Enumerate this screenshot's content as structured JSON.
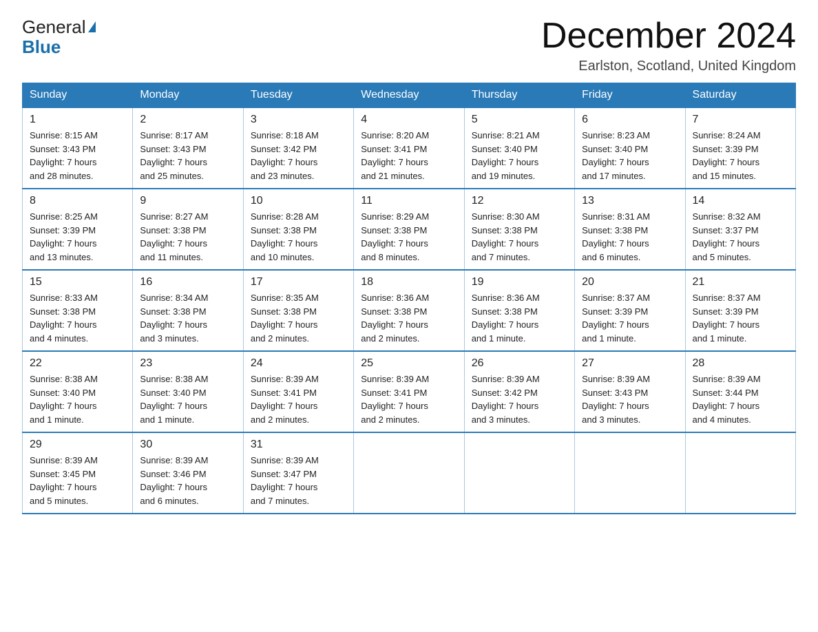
{
  "header": {
    "logo_general": "General",
    "logo_blue": "Blue",
    "month_title": "December 2024",
    "location": "Earlston, Scotland, United Kingdom"
  },
  "weekdays": [
    "Sunday",
    "Monday",
    "Tuesday",
    "Wednesday",
    "Thursday",
    "Friday",
    "Saturday"
  ],
  "weeks": [
    [
      {
        "day": "1",
        "sunrise": "8:15 AM",
        "sunset": "3:43 PM",
        "daylight": "7 hours and 28 minutes."
      },
      {
        "day": "2",
        "sunrise": "8:17 AM",
        "sunset": "3:43 PM",
        "daylight": "7 hours and 25 minutes."
      },
      {
        "day": "3",
        "sunrise": "8:18 AM",
        "sunset": "3:42 PM",
        "daylight": "7 hours and 23 minutes."
      },
      {
        "day": "4",
        "sunrise": "8:20 AM",
        "sunset": "3:41 PM",
        "daylight": "7 hours and 21 minutes."
      },
      {
        "day": "5",
        "sunrise": "8:21 AM",
        "sunset": "3:40 PM",
        "daylight": "7 hours and 19 minutes."
      },
      {
        "day": "6",
        "sunrise": "8:23 AM",
        "sunset": "3:40 PM",
        "daylight": "7 hours and 17 minutes."
      },
      {
        "day": "7",
        "sunrise": "8:24 AM",
        "sunset": "3:39 PM",
        "daylight": "7 hours and 15 minutes."
      }
    ],
    [
      {
        "day": "8",
        "sunrise": "8:25 AM",
        "sunset": "3:39 PM",
        "daylight": "7 hours and 13 minutes."
      },
      {
        "day": "9",
        "sunrise": "8:27 AM",
        "sunset": "3:38 PM",
        "daylight": "7 hours and 11 minutes."
      },
      {
        "day": "10",
        "sunrise": "8:28 AM",
        "sunset": "3:38 PM",
        "daylight": "7 hours and 10 minutes."
      },
      {
        "day": "11",
        "sunrise": "8:29 AM",
        "sunset": "3:38 PM",
        "daylight": "7 hours and 8 minutes."
      },
      {
        "day": "12",
        "sunrise": "8:30 AM",
        "sunset": "3:38 PM",
        "daylight": "7 hours and 7 minutes."
      },
      {
        "day": "13",
        "sunrise": "8:31 AM",
        "sunset": "3:38 PM",
        "daylight": "7 hours and 6 minutes."
      },
      {
        "day": "14",
        "sunrise": "8:32 AM",
        "sunset": "3:37 PM",
        "daylight": "7 hours and 5 minutes."
      }
    ],
    [
      {
        "day": "15",
        "sunrise": "8:33 AM",
        "sunset": "3:38 PM",
        "daylight": "7 hours and 4 minutes."
      },
      {
        "day": "16",
        "sunrise": "8:34 AM",
        "sunset": "3:38 PM",
        "daylight": "7 hours and 3 minutes."
      },
      {
        "day": "17",
        "sunrise": "8:35 AM",
        "sunset": "3:38 PM",
        "daylight": "7 hours and 2 minutes."
      },
      {
        "day": "18",
        "sunrise": "8:36 AM",
        "sunset": "3:38 PM",
        "daylight": "7 hours and 2 minutes."
      },
      {
        "day": "19",
        "sunrise": "8:36 AM",
        "sunset": "3:38 PM",
        "daylight": "7 hours and 1 minute."
      },
      {
        "day": "20",
        "sunrise": "8:37 AM",
        "sunset": "3:39 PM",
        "daylight": "7 hours and 1 minute."
      },
      {
        "day": "21",
        "sunrise": "8:37 AM",
        "sunset": "3:39 PM",
        "daylight": "7 hours and 1 minute."
      }
    ],
    [
      {
        "day": "22",
        "sunrise": "8:38 AM",
        "sunset": "3:40 PM",
        "daylight": "7 hours and 1 minute."
      },
      {
        "day": "23",
        "sunrise": "8:38 AM",
        "sunset": "3:40 PM",
        "daylight": "7 hours and 1 minute."
      },
      {
        "day": "24",
        "sunrise": "8:39 AM",
        "sunset": "3:41 PM",
        "daylight": "7 hours and 2 minutes."
      },
      {
        "day": "25",
        "sunrise": "8:39 AM",
        "sunset": "3:41 PM",
        "daylight": "7 hours and 2 minutes."
      },
      {
        "day": "26",
        "sunrise": "8:39 AM",
        "sunset": "3:42 PM",
        "daylight": "7 hours and 3 minutes."
      },
      {
        "day": "27",
        "sunrise": "8:39 AM",
        "sunset": "3:43 PM",
        "daylight": "7 hours and 3 minutes."
      },
      {
        "day": "28",
        "sunrise": "8:39 AM",
        "sunset": "3:44 PM",
        "daylight": "7 hours and 4 minutes."
      }
    ],
    [
      {
        "day": "29",
        "sunrise": "8:39 AM",
        "sunset": "3:45 PM",
        "daylight": "7 hours and 5 minutes."
      },
      {
        "day": "30",
        "sunrise": "8:39 AM",
        "sunset": "3:46 PM",
        "daylight": "7 hours and 6 minutes."
      },
      {
        "day": "31",
        "sunrise": "8:39 AM",
        "sunset": "3:47 PM",
        "daylight": "7 hours and 7 minutes."
      },
      null,
      null,
      null,
      null
    ]
  ],
  "labels": {
    "sunrise": "Sunrise:",
    "sunset": "Sunset:",
    "daylight": "Daylight:"
  }
}
